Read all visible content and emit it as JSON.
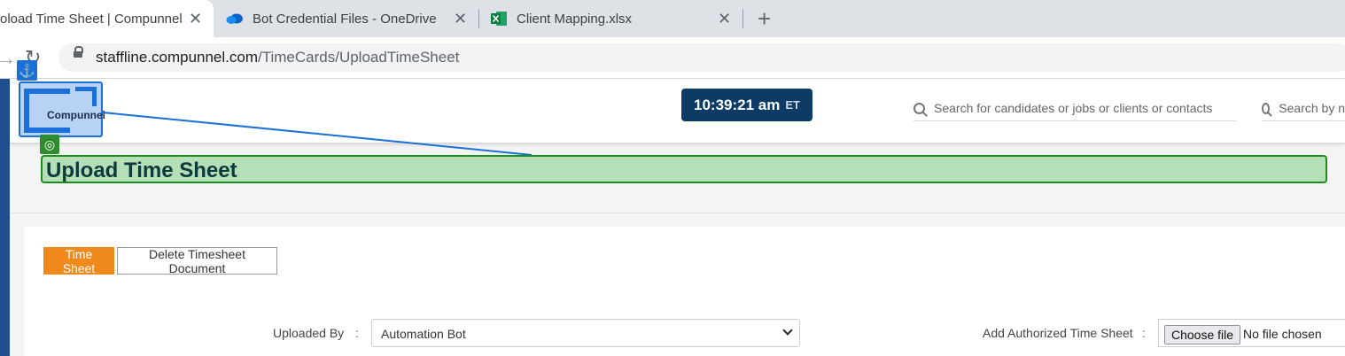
{
  "browser": {
    "tabs": [
      {
        "title": "oload Time Sheet | Compunnel",
        "active": true
      },
      {
        "title": "Bot Credential Files - OneDrive",
        "icon": "onedrive-cloud-icon"
      },
      {
        "title": "Client Mapping.xlsx",
        "icon": "excel-icon"
      }
    ],
    "tab_close": "✕",
    "new_tab": "+",
    "url_host": "staffline.compunnel.com",
    "url_path": "/TimeCards/UploadTimeSheet"
  },
  "header": {
    "logo_text": "Compunnel",
    "clock_time": "10:39:21 am",
    "clock_tz": "ET",
    "search1_placeholder": "Search for candidates or jobs or clients or contacts",
    "search2_placeholder": "Search by n"
  },
  "annotations": {
    "anchor_glyph": "⚓",
    "target_glyph": "◎"
  },
  "page": {
    "title": "Upload Time Sheet",
    "buttons": {
      "time_sheet": "Time Sheet",
      "delete_doc": "Delete Timesheet Document"
    },
    "form": {
      "uploaded_by_label": "Uploaded By",
      "colon": ":",
      "uploaded_by_value": "Automation Bot",
      "add_auth_label": "Add Authorized Time Sheet",
      "choose_file": "Choose file",
      "no_file": "No file chosen"
    }
  },
  "colors": {
    "accent_orange": "#f0891b",
    "clock_bg": "#0d3b66",
    "anchor_blue": "#1a6fd8",
    "target_green": "#1e8c1e"
  }
}
